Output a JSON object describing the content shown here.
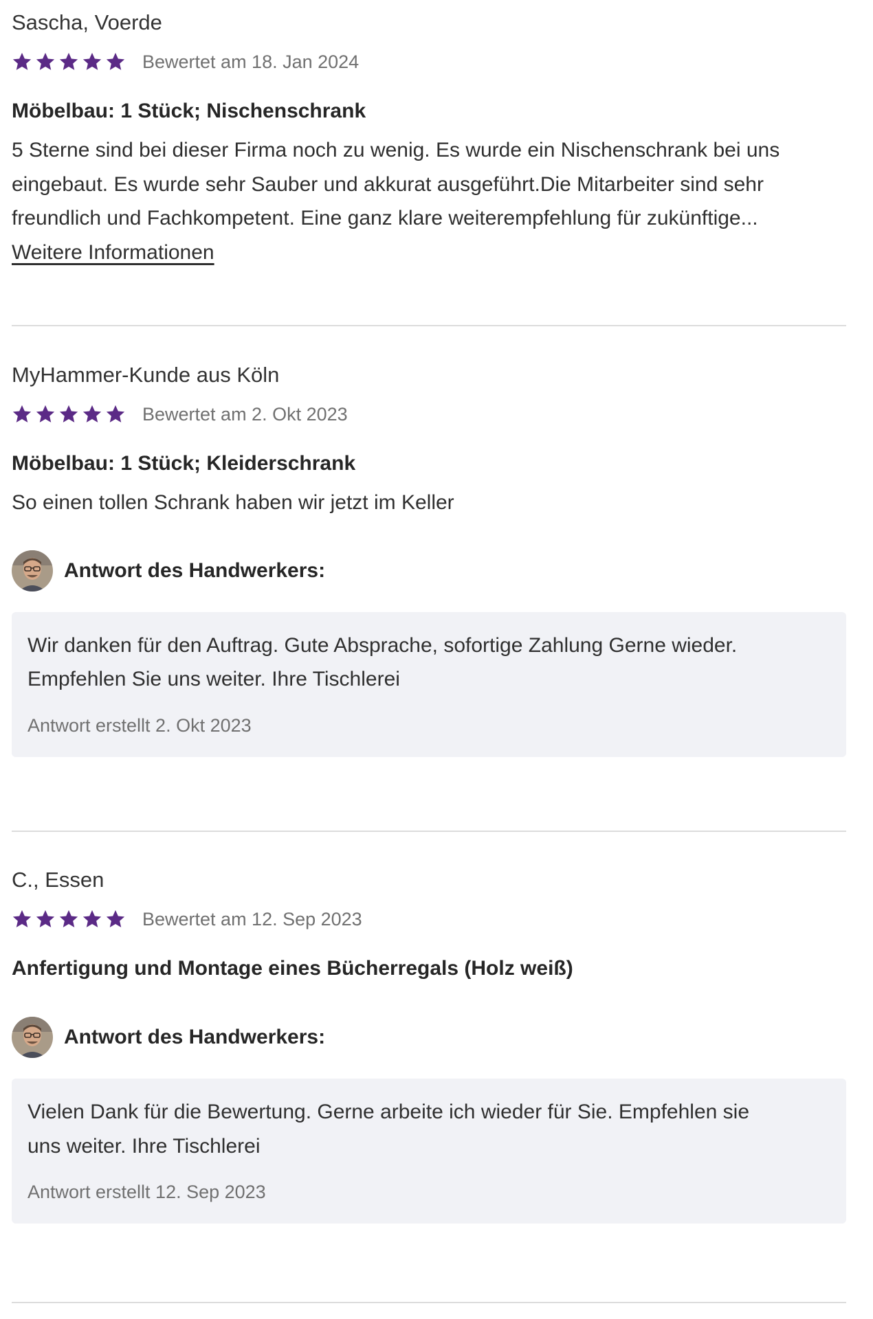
{
  "reviews": [
    {
      "author": "Sascha, Voerde",
      "rating": 5,
      "rated_date": "Bewertet am 18. Jan 2024",
      "title": "Möbelbau: 1 Stück; Nischenschrank",
      "text_lines": [
        "5 Sterne sind bei dieser Firma noch zu wenig. Es wurde ein Nischenschrank bei uns",
        "eingebaut. Es wurde sehr Sauber und akkurat ausgeführt.Die Mitarbeiter sind sehr",
        "freundlich und Fachkompetent. Eine ganz klare weiterempfehlung für zukünftige..."
      ],
      "more_link": "Weitere Informationen"
    },
    {
      "author": "MyHammer-Kunde aus Köln",
      "rating": 5,
      "rated_date": "Bewertet am 2. Okt 2023",
      "title": "Möbelbau: 1 Stück; Kleiderschrank",
      "text_lines": [
        "So einen tollen Schrank haben wir jetzt im Keller"
      ],
      "answer": {
        "label": "Antwort des Handwerkers:",
        "text_lines": [
          "Wir danken für den Auftrag. Gute Absprache, sofortige Zahlung Gerne wieder.",
          "Empfehlen Sie uns weiter. Ihre Tischlerei"
        ],
        "date": "Antwort erstellt 2. Okt 2023"
      }
    },
    {
      "author": "C., Essen",
      "rating": 5,
      "rated_date": "Bewertet am 12. Sep 2023",
      "title": "Anfertigung und Montage eines Bücherregals (Holz weiß)",
      "answer": {
        "label": "Antwort des Handwerkers:",
        "text_lines": [
          "Vielen Dank für die Bewertung. Gerne arbeite ich wieder für Sie. Empfehlen sie",
          "uns weiter. Ihre Tischlerei"
        ],
        "date": "Antwort erstellt 12. Sep 2023"
      }
    }
  ],
  "colors": {
    "star": "#5b2a86",
    "answer_background": "#f1f2f6",
    "divider": "#dcdcdc"
  },
  "icons": {
    "star": "star-icon",
    "avatar": "craftsman-avatar"
  }
}
